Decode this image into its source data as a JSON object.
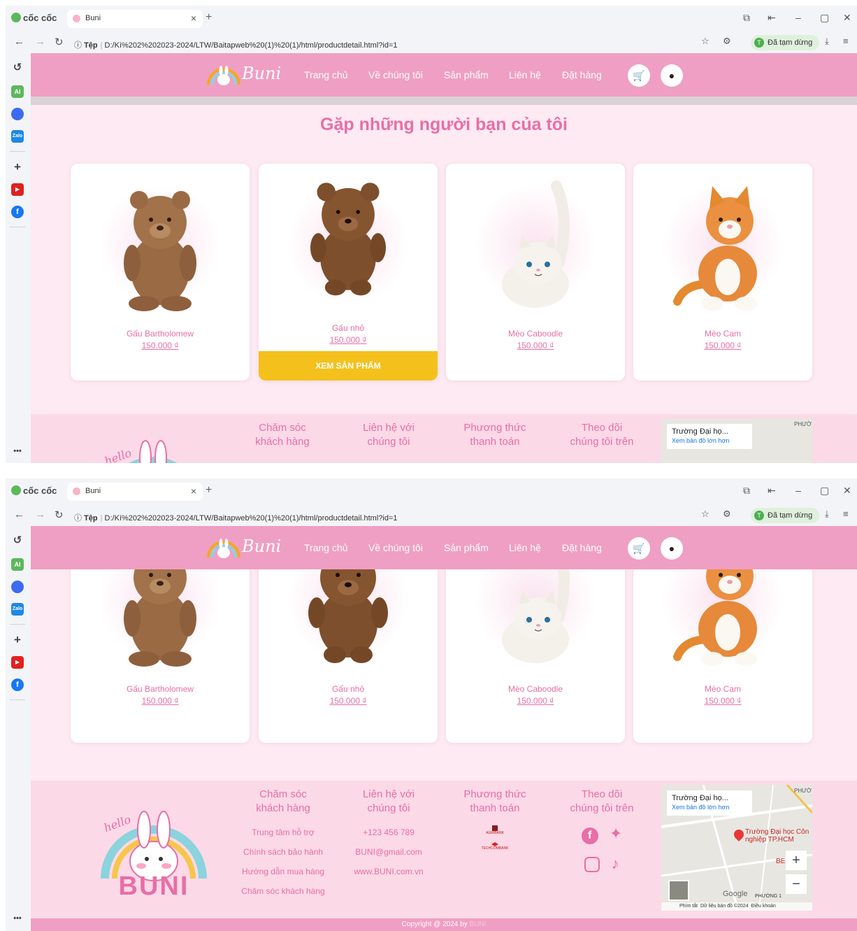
{
  "browser": {
    "brand": "cốc cốc",
    "tab_title": "Buni",
    "tab_close": "×",
    "new_tab": "+",
    "url_scheme": "Tệp",
    "url": "D:/Kì%202%202023-2024/LTW/Baitapweb%20(1)%20(1)/html/productdetail.html?id=1",
    "profile_status": "Đã tạm dừng",
    "profile_initial": "T",
    "win_min": "–",
    "win_max": "▢",
    "win_close": "✕"
  },
  "nav": {
    "logo_text": "Buni",
    "links": [
      "Trang chủ",
      "Về chúng tôi",
      "Sản phẩm",
      "Liên hệ",
      "Đặt hàng"
    ],
    "cart_icon": "shopping-cart-icon",
    "user_icon": "user-icon"
  },
  "section": {
    "heading": "Gặp những người bạn của tôi"
  },
  "products": [
    {
      "name": "Gấu Bartholomew",
      "price": "150.000 ₫"
    },
    {
      "name": "Gấu nhỏ",
      "price": "150.000 ₫",
      "button": "XEM SẢN PHẨM"
    },
    {
      "name": "Mèo Caboodle",
      "price": "150.000 ₫"
    },
    {
      "name": "Mèo Cam",
      "price": "150.000 ₫"
    }
  ],
  "footer": {
    "logo_hello": "hello",
    "logo_brand": "BUNI",
    "care_heading_1": "Chăm sóc",
    "care_heading_2": "khách hàng",
    "care_links": [
      "Trung tâm hỗ trợ",
      "Chính sách bảo hành",
      "Hướng dẫn mua hàng",
      "Chăm sóc khách hàng"
    ],
    "contact_heading_1": "Liên hệ với",
    "contact_heading_2": "chúng tôi",
    "contact_links": [
      "+123 456 789",
      "BUNI@gmail.com",
      "www.BUNI.com.vn"
    ],
    "payment_heading_1": "Phương thức",
    "payment_heading_2": "thanh toán",
    "payment_logos": [
      "AGRIBANK",
      "TECHCOMBANK"
    ],
    "follow_heading_1": "Theo dõi",
    "follow_heading_2": "chúng tôi trên",
    "social_icons": [
      "facebook-icon",
      "twitter-icon",
      "instagram-icon",
      "tiktok-icon"
    ],
    "copyright": "Copyright @ 2024 by",
    "copyright_brand": "BUNI"
  },
  "map": {
    "place": "Trường Đại họ...",
    "view_larger": "Xem bản đồ lớn hơn",
    "pin_label": "Trường Đại học Côn nghiệp TP.HCM",
    "district": "PHƯỜNG 1",
    "top_label": "PHƯỜ",
    "google": "Google",
    "shortcuts": "Phím tắt",
    "map_data": "Dữ liệu bản đồ ©2024",
    "terms": "Điều khoản",
    "zoom_in": "+",
    "zoom_out": "−",
    "edge_label": "BE"
  },
  "colors": {
    "nav_pink": "#ef9fc3",
    "page_bg": "#fdeaf2",
    "accent_pink": "#e86ea7",
    "button_yellow": "#f4c11c"
  }
}
